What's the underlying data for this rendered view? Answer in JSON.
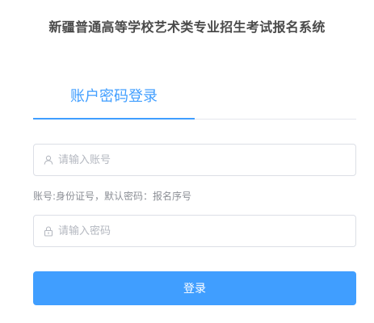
{
  "header": {
    "title": "新疆普通高等学校艺术类专业招生考试报名系统"
  },
  "tabs": [
    {
      "label": "账户密码登录",
      "active": true
    }
  ],
  "form": {
    "username": {
      "value": "",
      "placeholder": "请输入账号",
      "icon": "user-icon"
    },
    "hint": "账号:身份证号，默认密码：报名序号",
    "password": {
      "value": "",
      "placeholder": "请输入密码",
      "icon": "lock-icon"
    },
    "submit_label": "登录"
  },
  "colors": {
    "accent": "#409eff",
    "border": "#dcdfe6",
    "title_text": "#4a4a4a",
    "hint_text": "#8c8f96",
    "placeholder": "#b4b8c0"
  }
}
